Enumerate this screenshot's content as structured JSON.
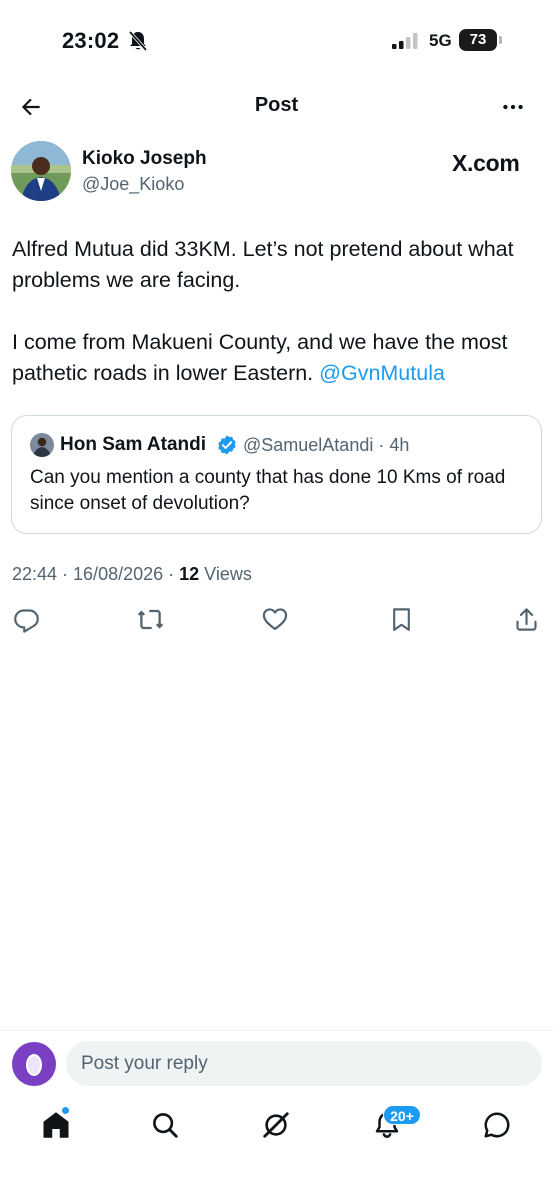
{
  "status_bar": {
    "time": "23:02",
    "network": "5G",
    "battery": "73"
  },
  "header": {
    "title": "Post"
  },
  "tweet": {
    "author_name": "Kioko Joseph",
    "author_handle": "@Joe_Kioko",
    "source": "X.com",
    "paragraph1": "Alfred Mutua did 33KM. Let’s not pretend about what problems we are facing.",
    "paragraph2_text": "I come from  Makueni County, and we have the most pathetic roads in lower Eastern. ",
    "paragraph2_mention": "@GvnMutula",
    "timestamp": "22:44 · 16/08/2026 · ",
    "views_count": "12",
    "views_label": " Views"
  },
  "quote": {
    "author_name": "Hon Sam Atandi",
    "author_handle": "@SamuelAtandi",
    "time": " · 4h",
    "text": "Can you mention a county that has done 10 Kms of road since onset of devolution?"
  },
  "actions": [
    {
      "name": "reply-icon"
    },
    {
      "name": "repost-icon"
    },
    {
      "name": "like-icon"
    },
    {
      "name": "bookmark-icon"
    },
    {
      "name": "share-icon"
    }
  ],
  "reply": {
    "placeholder": "Post your reply"
  },
  "bottom_nav": {
    "notifications_badge": "20+"
  },
  "colors": {
    "accent": "#1d9bf0",
    "text": "#0f1419",
    "secondary": "#536471",
    "reply_avatar": "#7b3fc4"
  }
}
